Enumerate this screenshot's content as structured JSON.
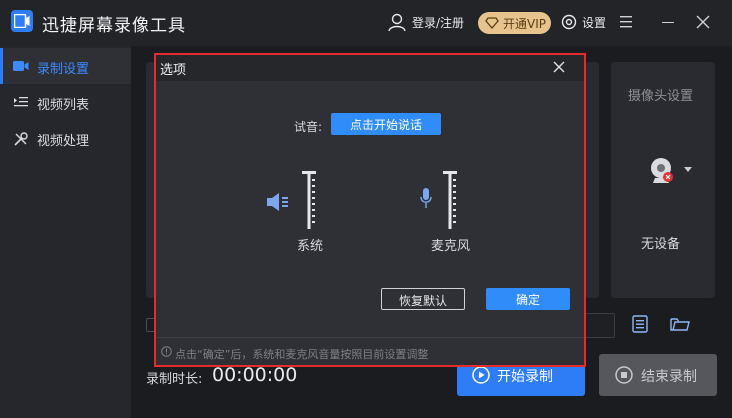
{
  "app": {
    "title": "迅捷屏幕录像工具"
  },
  "titlebar": {
    "login_label": "登录/注册",
    "vip_label": "开通VIP",
    "settings_label": "设置"
  },
  "sidebar": {
    "items": [
      {
        "label": "录制设置",
        "icon": "camera-icon",
        "active": true
      },
      {
        "label": "视频列表",
        "icon": "list-play-icon",
        "active": false
      },
      {
        "label": "视频处理",
        "icon": "tools-icon",
        "active": false
      }
    ]
  },
  "camera_panel": {
    "title": "摄像头设置",
    "status": "无设备"
  },
  "recording": {
    "time_label": "录制时长:",
    "time_value": "00:00:00",
    "start_label": "开始录制",
    "stop_label": "结束录制"
  },
  "dialog": {
    "title": "选项",
    "try_label": "试音:",
    "try_button": "点击开始说话",
    "system_label": "系统",
    "mic_label": "麦克风",
    "reset_button": "恢复默认",
    "ok_button": "确定",
    "tip": "点击“确定”后，系统和麦克风音量按照目前设置调整"
  },
  "colors": {
    "accent": "#2f7df6",
    "highlight_border": "#e52b2b",
    "vip_gold": "#e7c48d"
  }
}
